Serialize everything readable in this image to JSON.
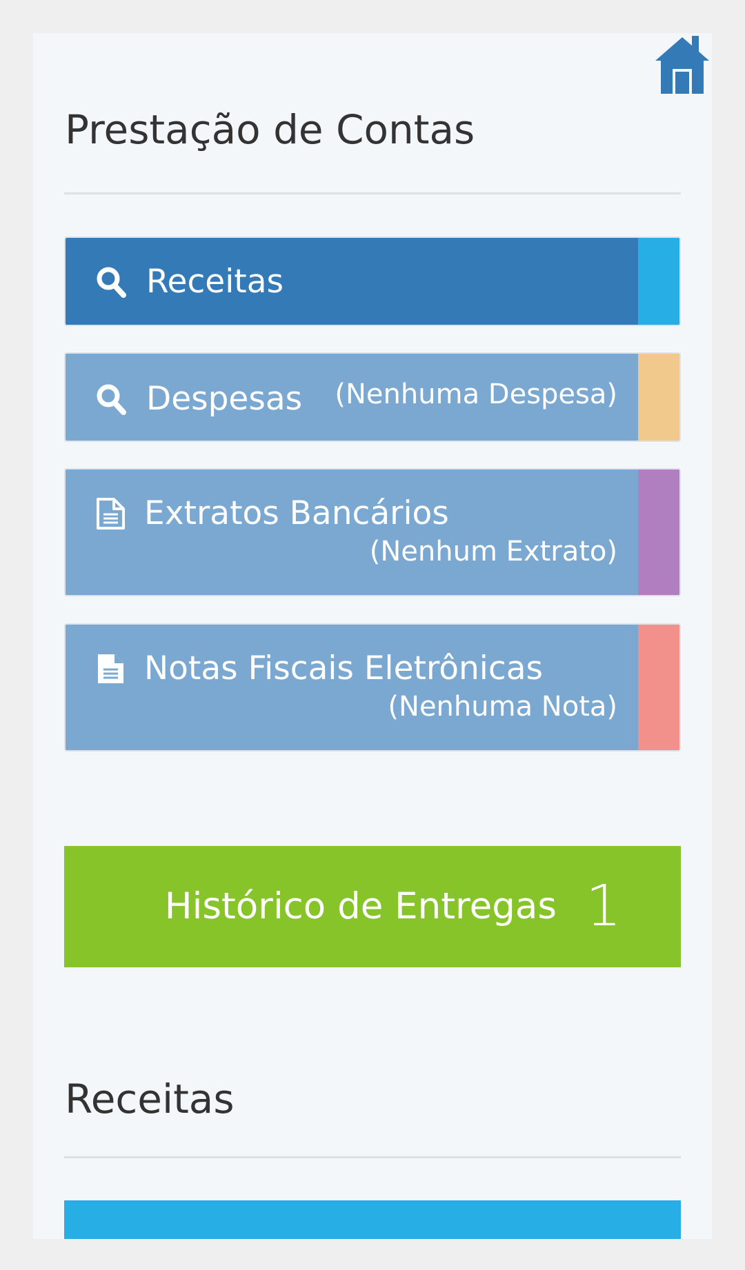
{
  "header": {
    "title": "Prestação de Contas",
    "home_icon": "home-icon"
  },
  "menu": [
    {
      "label": "Receitas",
      "sub": "",
      "icon": "search-icon",
      "bg_color": "#347ab7",
      "accent_color": "#27aee4"
    },
    {
      "label": "Despesas",
      "sub": "(Nenhuma Despesa)",
      "icon": "search-icon",
      "bg_color": "#7aa8d1",
      "accent_color": "#f2c98d"
    },
    {
      "label": "Extratos Bancários",
      "sub": "(Nenhum Extrato)",
      "icon": "document-outline-icon",
      "bg_color": "#7aa8d1",
      "accent_color": "#b07fc0"
    },
    {
      "label": "Notas Fiscais Eletrônicas",
      "sub": "(Nenhuma Nota)",
      "icon": "document-filled-icon",
      "bg_color": "#7aa8d1",
      "accent_color": "#f2918b"
    }
  ],
  "history": {
    "label": "Histórico de Entregas",
    "count": "1",
    "color": "#87c429"
  },
  "section": {
    "title": "Receitas",
    "bar_color": "#27aee4"
  }
}
